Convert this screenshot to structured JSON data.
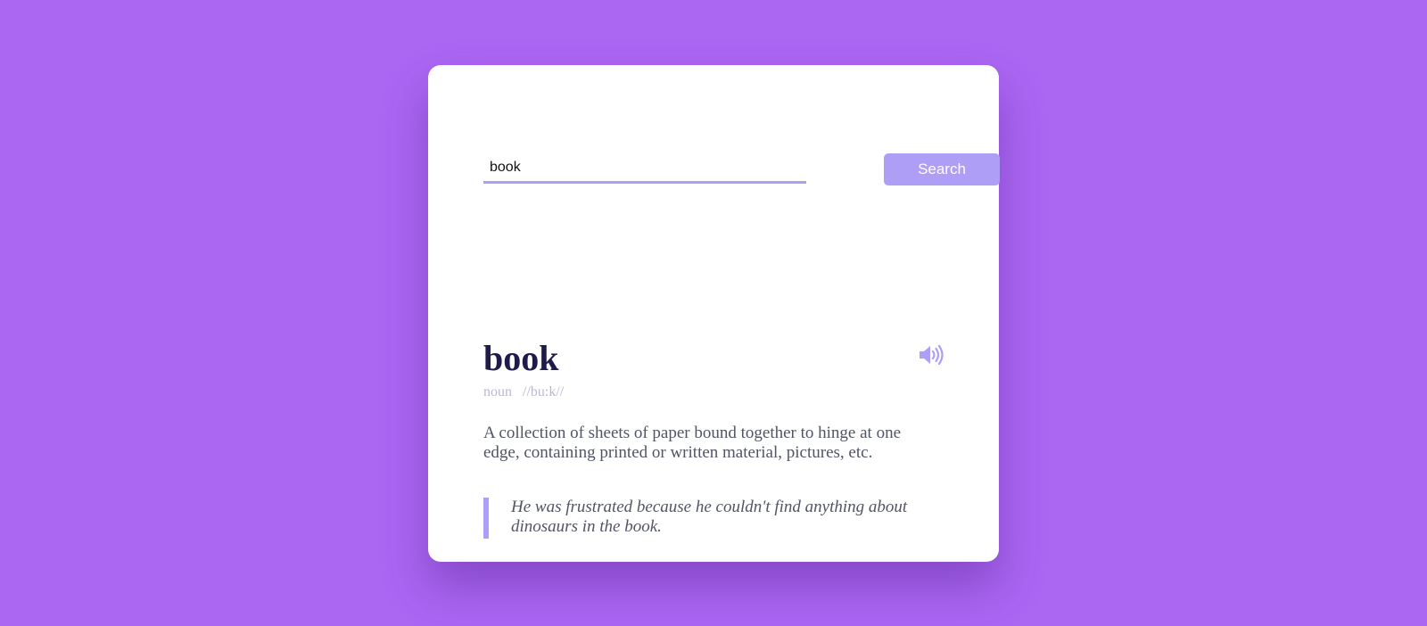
{
  "search": {
    "value": "book",
    "button_label": "Search"
  },
  "result": {
    "word": "book",
    "part_of_speech": "noun",
    "phonetic": "//bu:k//",
    "definition": "A collection of sheets of paper bound together to hinge at one edge, containing printed or written material, pictures, etc.",
    "example": "He was frustrated because he couldn't find anything about dinosaurs in the book.",
    "audio_icon": "speaker-volume-icon"
  },
  "colors": {
    "background": "#ab66f2",
    "accent": "#ae9ef6",
    "word": "#1e1b4b",
    "text": "#505566",
    "muted": "#bcb6d6"
  }
}
